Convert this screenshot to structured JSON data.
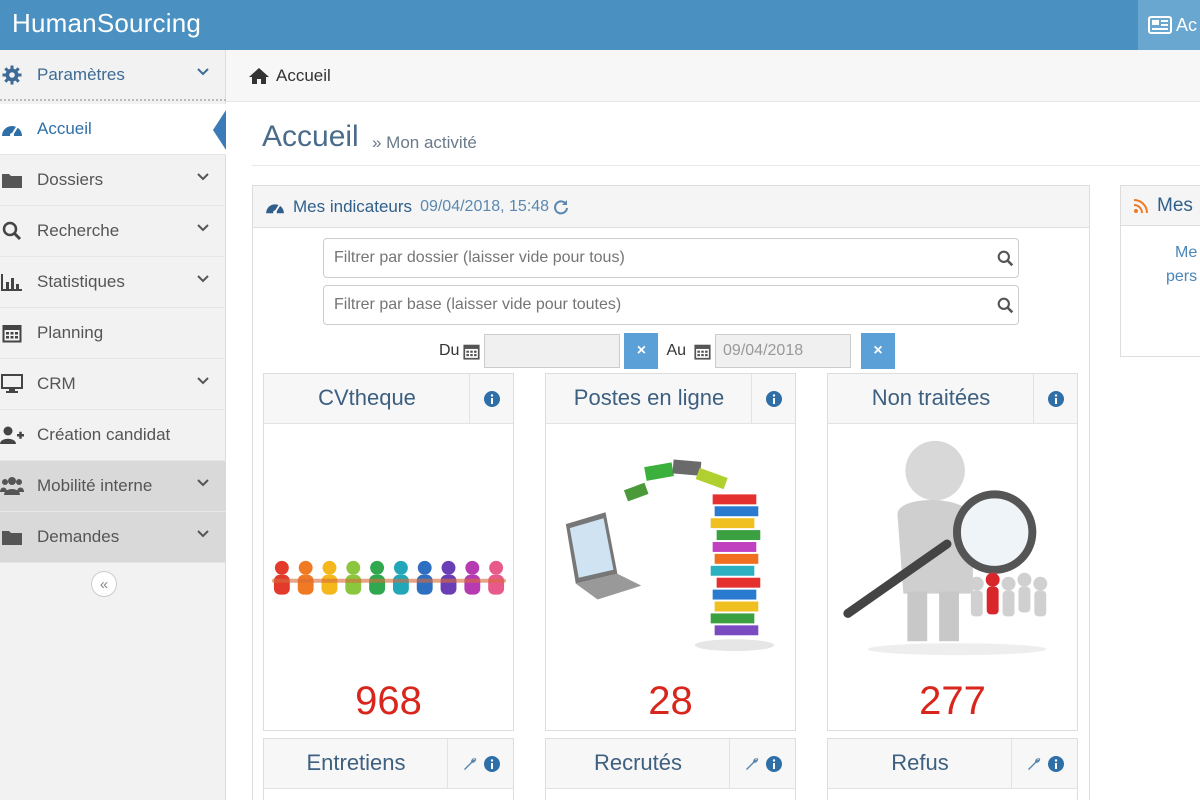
{
  "app": {
    "title": "HumanSourcing",
    "top_right_label": "Ac"
  },
  "sidebar": {
    "items": [
      {
        "label": "Paramètres",
        "icon": "gear-icon"
      },
      {
        "label": "Accueil",
        "icon": "dashboard-icon"
      },
      {
        "label": "Dossiers",
        "icon": "folder-icon"
      },
      {
        "label": "Recherche",
        "icon": "search-icon"
      },
      {
        "label": "Statistiques",
        "icon": "bar-chart-icon"
      },
      {
        "label": "Planning",
        "icon": "calendar-icon"
      },
      {
        "label": "CRM",
        "icon": "monitor-icon"
      },
      {
        "label": "Création candidat",
        "icon": "user-plus-icon"
      },
      {
        "label": "Mobilité interne",
        "icon": "users-icon"
      },
      {
        "label": "Demandes",
        "icon": "folder-icon"
      }
    ],
    "collapse_label": "«"
  },
  "breadcrumb": {
    "home_label": "Accueil"
  },
  "page": {
    "title": "Accueil",
    "subtitle": "» Mon activité"
  },
  "indicators": {
    "title": "Mes indicateurs",
    "timestamp": "09/04/2018, 15:48",
    "filter_dossier_placeholder": "Filtrer par dossier (laisser vide pour tous)",
    "filter_base_placeholder": "Filtrer par base (laisser vide pour toutes)",
    "du_label": "Du",
    "du_value": "",
    "au_label": "Au",
    "au_value": "09/04/2018",
    "clear_label": "×"
  },
  "cards": [
    {
      "title": "CVtheque",
      "value": "968"
    },
    {
      "title": "Postes en ligne",
      "value": "28"
    },
    {
      "title": "Non traitées",
      "value": "277"
    },
    {
      "title": "Entretiens"
    },
    {
      "title": "Recrutés"
    },
    {
      "title": "Refus"
    }
  ],
  "right_panel": {
    "title": "Mes",
    "line1": "Me",
    "line2": "pers"
  },
  "colors": {
    "topbar": "#4a91c2",
    "accent": "#3b7cb8",
    "value_red": "#d9261c"
  }
}
